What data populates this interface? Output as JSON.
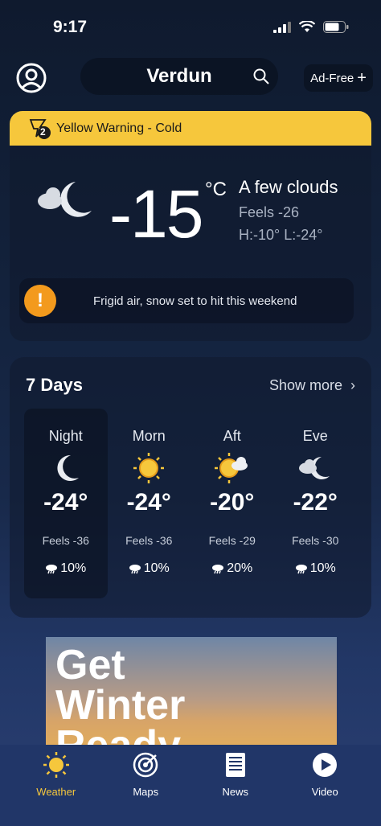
{
  "status": {
    "time": "9:17"
  },
  "header": {
    "city": "Verdun",
    "adfree_label": "Ad-Free"
  },
  "current": {
    "warning": "Yellow Warning - Cold",
    "warning_count": "2",
    "temp": "-15",
    "unit": "°C",
    "condition": "A few clouds",
    "feels": "Feels -26",
    "hilo": "H:-10° L:-24°",
    "alert": "Frigid air, snow set to hit this weekend"
  },
  "days": {
    "title": "7 Days",
    "show_more": "Show more",
    "periods": [
      {
        "name": "Night",
        "temp": "-24°",
        "feels": "Feels -36",
        "precip": "10%",
        "icon": "moon-icon"
      },
      {
        "name": "Morn",
        "temp": "-24°",
        "feels": "Feels -36",
        "precip": "10%",
        "icon": "sun-icon"
      },
      {
        "name": "Aft",
        "temp": "-20°",
        "feels": "Feels -29",
        "precip": "20%",
        "icon": "sun-cloud-icon"
      },
      {
        "name": "Eve",
        "temp": "-22°",
        "feels": "Feels -30",
        "precip": "10%",
        "icon": "moon-cloud-icon"
      }
    ]
  },
  "ad": {
    "line1": "Get",
    "line2": "Winter",
    "line3": "Ready"
  },
  "tabs": [
    {
      "label": "Weather",
      "icon": "sun-icon"
    },
    {
      "label": "Maps",
      "icon": "radar-icon"
    },
    {
      "label": "News",
      "icon": "newspaper-icon"
    },
    {
      "label": "Video",
      "icon": "play-icon"
    }
  ],
  "colors": {
    "warning": "#f6c73c",
    "alert": "#f39a1d",
    "tabbar": "#213668"
  }
}
